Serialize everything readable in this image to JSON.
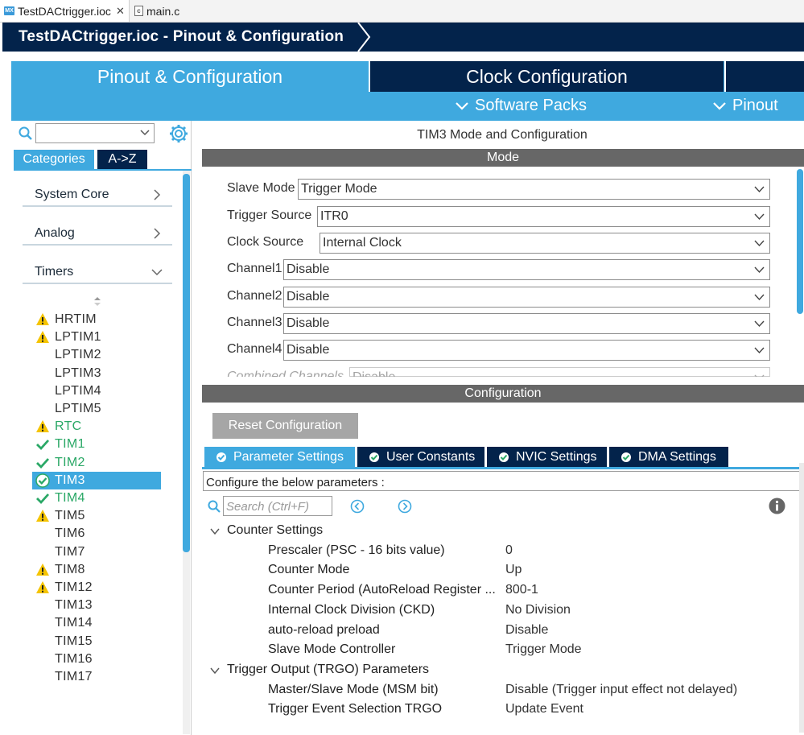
{
  "editor_tabs": [
    {
      "label": "TestDACtrigger.ioc",
      "icon": "mx-file-icon",
      "closable": true
    },
    {
      "label": "main.c",
      "icon": "c-file-icon",
      "closable": false
    }
  ],
  "breadcrumb": {
    "title": "TestDACtrigger.ioc - Pinout & Configuration"
  },
  "main_tabs": {
    "pinout_config": "Pinout & Configuration",
    "clock_config": "Clock Configuration",
    "software_packs": "Software Packs",
    "pinout": "Pinout"
  },
  "left_panel": {
    "search": {
      "value": "",
      "icon": "search-icon"
    },
    "tabs": {
      "categories": "Categories",
      "az": "A->Z"
    },
    "categories": [
      {
        "label": "System Core",
        "state": "collapsed"
      },
      {
        "label": "Analog",
        "state": "collapsed"
      },
      {
        "label": "Timers",
        "state": "expanded"
      }
    ],
    "timers": [
      {
        "label": "HRTIM",
        "status": "warning"
      },
      {
        "label": "LPTIM1",
        "status": "warning"
      },
      {
        "label": "LPTIM2",
        "status": "none"
      },
      {
        "label": "LPTIM3",
        "status": "none"
      },
      {
        "label": "LPTIM4",
        "status": "none"
      },
      {
        "label": "LPTIM5",
        "status": "none"
      },
      {
        "label": "RTC",
        "status": "warning-green"
      },
      {
        "label": "TIM1",
        "status": "ok"
      },
      {
        "label": "TIM2",
        "status": "ok"
      },
      {
        "label": "TIM3",
        "status": "selected"
      },
      {
        "label": "TIM4",
        "status": "ok"
      },
      {
        "label": "TIM5",
        "status": "warning"
      },
      {
        "label": "TIM6",
        "status": "none"
      },
      {
        "label": "TIM7",
        "status": "none"
      },
      {
        "label": "TIM8",
        "status": "warning"
      },
      {
        "label": "TIM12",
        "status": "warning"
      },
      {
        "label": "TIM13",
        "status": "none"
      },
      {
        "label": "TIM14",
        "status": "none"
      },
      {
        "label": "TIM15",
        "status": "none"
      },
      {
        "label": "TIM16",
        "status": "none"
      },
      {
        "label": "TIM17",
        "status": "none"
      }
    ]
  },
  "right_panel": {
    "title": "TIM3 Mode and Configuration",
    "mode_header": "Mode",
    "mode_fields": [
      {
        "label": "Slave Mode",
        "value": "Trigger Mode"
      },
      {
        "label": "Trigger Source",
        "value": "ITR0"
      },
      {
        "label": "Clock Source",
        "value": "Internal Clock"
      },
      {
        "label": "Channel1",
        "value": "Disable"
      },
      {
        "label": "Channel2",
        "value": "Disable"
      },
      {
        "label": "Channel3",
        "value": "Disable"
      },
      {
        "label": "Channel4",
        "value": "Disable"
      },
      {
        "label": "Combined Channels",
        "value": "Disable"
      }
    ],
    "config_header": "Configuration",
    "reset_button": "Reset Configuration",
    "config_tabs": [
      "Parameter Settings",
      "User Constants",
      "NVIC Settings",
      "DMA Settings"
    ],
    "config_desc": "Configure the below parameters :",
    "param_search_placeholder": "Search (Ctrl+F)",
    "groups": [
      {
        "title": "Counter Settings",
        "params": [
          {
            "name": "Prescaler (PSC - 16 bits value)",
            "value": "0"
          },
          {
            "name": "Counter Mode",
            "value": "Up"
          },
          {
            "name": "Counter Period (AutoReload Register ...",
            "value": "800-1"
          },
          {
            "name": "Internal Clock Division (CKD)",
            "value": "No Division"
          },
          {
            "name": "auto-reload preload",
            "value": "Disable"
          },
          {
            "name": "Slave Mode Controller",
            "value": "Trigger Mode"
          }
        ]
      },
      {
        "title": "Trigger Output (TRGO) Parameters",
        "params": [
          {
            "name": "Master/Slave Mode (MSM bit)",
            "value": "Disable (Trigger input effect not delayed)"
          },
          {
            "name": "Trigger Event Selection TRGO",
            "value": "Update Event"
          }
        ]
      }
    ]
  },
  "colors": {
    "navy": "#03234b",
    "accent": "#3fa9df",
    "ok_green": "#2aa866",
    "warning": "#f5c400",
    "section_gray": "#676767"
  }
}
